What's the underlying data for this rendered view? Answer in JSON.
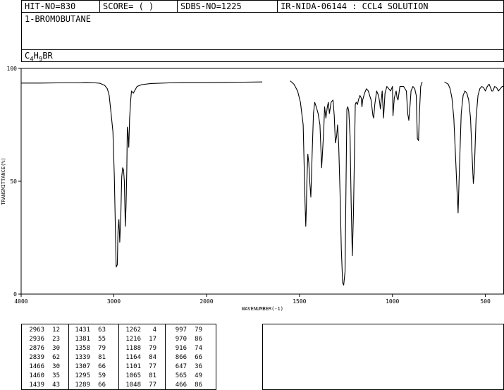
{
  "header": {
    "hit_no": "HIT-NO=830",
    "score": "SCORE=  (  )",
    "sdbs_no": "SDBS-NO=1225",
    "ir_info": "IR-NIDA-06144 : CCL4 SOLUTION"
  },
  "compound": {
    "name": "1-BROMOBUTANE",
    "formula": "C4H9BR"
  },
  "chart_data": {
    "type": "line",
    "title": "",
    "xlabel": "WAVENUMBER(-1)",
    "ylabel": "TRANSMITTANCE(%)",
    "xlim": [
      4000,
      400
    ],
    "ylim": [
      0,
      100
    ],
    "x_ticks": [
      4000,
      3000,
      2000,
      1500,
      1000,
      500
    ],
    "y_ticks": [
      0,
      50,
      100
    ],
    "segments": [
      {
        "x": [
          4000,
          3800,
          3600,
          3400,
          3300,
          3200,
          3150,
          3100,
          3070,
          3050,
          3030,
          3010,
          2995,
          2985,
          2975,
          2963,
          2955,
          2945,
          2936,
          2925,
          2915,
          2905,
          2895,
          2887,
          2876,
          2868,
          2860,
          2855,
          2848,
          2839,
          2830,
          2820,
          2810,
          2790,
          2770,
          2750,
          2700,
          2600,
          2400,
          2200,
          2000,
          1900,
          1800,
          1700
        ],
        "y": [
          93.5,
          93.5,
          93.6,
          93.6,
          93.7,
          93.6,
          93.4,
          92.5,
          91,
          88,
          80,
          72,
          52,
          32,
          12,
          13,
          28,
          33,
          23,
          35,
          52,
          56,
          55,
          50,
          30,
          40,
          55,
          74,
          72,
          65,
          78,
          85,
          90,
          89,
          90.5,
          92,
          92.8,
          93.3,
          93.6,
          93.7,
          93.7,
          93.8,
          93.9,
          94
        ]
      },
      {
        "x": [
          1550,
          1530,
          1510,
          1495,
          1480,
          1470,
          1466,
          1463,
          1460,
          1455,
          1450,
          1445,
          1439,
          1432,
          1425,
          1418,
          1410,
          1400,
          1390,
          1381,
          1370,
          1365,
          1358,
          1350,
          1345,
          1339,
          1330,
          1320,
          1313,
          1307,
          1300,
          1295,
          1289,
          1282,
          1275,
          1268,
          1262,
          1255,
          1245,
          1240,
          1235,
          1228,
          1222,
          1216,
          1210,
          1200,
          1195,
          1188,
          1183,
          1175,
          1168,
          1164,
          1160,
          1150,
          1140,
          1130,
          1115,
          1105,
          1101,
          1095,
          1085,
          1075,
          1069,
          1065,
          1060,
          1055,
          1048,
          1040,
          1030,
          1020,
          1010,
          1000,
          997,
          990,
          980,
          975,
          970,
          965,
          960,
          950,
          940,
          925,
          918,
          912,
          905,
          900,
          890,
          880,
          872,
          866,
          860,
          855,
          848,
          840
        ],
        "y": [
          94.5,
          93,
          90,
          85,
          75,
          40,
          30,
          38,
          50,
          62,
          58,
          50,
          43,
          62,
          80,
          85,
          83,
          80,
          75,
          56,
          72,
          83,
          78,
          83,
          85,
          80,
          85,
          86,
          79,
          67,
          70,
          75,
          66,
          45,
          20,
          5,
          4,
          10,
          82,
          83,
          81,
          70,
          40,
          17,
          35,
          84,
          85,
          84,
          86,
          88,
          87,
          83,
          86,
          89,
          91,
          90,
          86,
          79,
          78,
          84,
          90,
          88,
          85,
          82,
          86,
          90,
          78,
          89,
          92,
          91,
          90,
          92,
          79,
          87,
          90,
          87,
          86,
          89,
          92,
          92,
          92,
          90,
          80,
          77,
          84,
          90,
          92,
          91,
          88,
          69,
          68,
          80,
          92,
          94
        ]
      },
      {
        "x": [
          720,
          700,
          690,
          680,
          670,
          660,
          652,
          647,
          640,
          630,
          620,
          610,
          600,
          590,
          580,
          570,
          565,
          560,
          550,
          540,
          530,
          520,
          510,
          500,
          490,
          480,
          470,
          466,
          460,
          450,
          440,
          430,
          420,
          410,
          400
        ],
        "y": [
          94,
          93,
          91,
          87,
          78,
          60,
          45,
          36,
          55,
          80,
          88,
          90,
          89,
          86,
          78,
          58,
          49,
          54,
          78,
          88,
          91,
          92,
          91.5,
          90,
          92,
          93,
          91,
          90,
          90,
          92,
          91.5,
          90,
          91,
          92,
          92
        ]
      }
    ]
  },
  "peak_table": [
    [
      "2963",
      "12"
    ],
    [
      "2936",
      "23"
    ],
    [
      "2876",
      "30"
    ],
    [
      "2839",
      "62"
    ],
    [
      "1466",
      "30"
    ],
    [
      "1460",
      "35"
    ],
    [
      "1439",
      "43"
    ],
    [
      "1431",
      "63"
    ],
    [
      "1381",
      "55"
    ],
    [
      "1358",
      "79"
    ],
    [
      "1339",
      "81"
    ],
    [
      "1307",
      "66"
    ],
    [
      "1295",
      "59"
    ],
    [
      "1289",
      "66"
    ],
    [
      "1262",
      "4"
    ],
    [
      "1216",
      "17"
    ],
    [
      "1188",
      "79"
    ],
    [
      "1164",
      "84"
    ],
    [
      "1101",
      "77"
    ],
    [
      "1065",
      "81"
    ],
    [
      "1048",
      "77"
    ],
    [
      "997",
      "79"
    ],
    [
      "970",
      "86"
    ],
    [
      "916",
      "74"
    ],
    [
      "866",
      "66"
    ],
    [
      "647",
      "36"
    ],
    [
      "565",
      "49"
    ],
    [
      "466",
      "86"
    ]
  ]
}
